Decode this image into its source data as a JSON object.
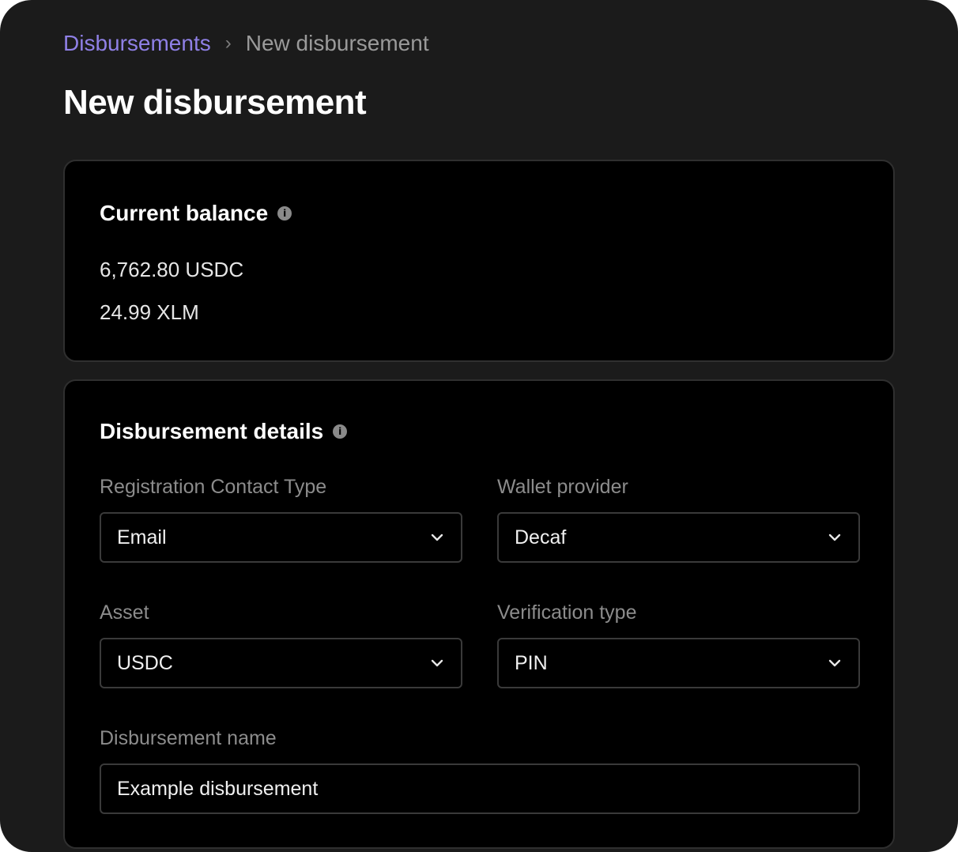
{
  "breadcrumb": {
    "parent": "Disbursements",
    "separator": "›",
    "current": "New disbursement"
  },
  "page_title": "New disbursement",
  "balance_card": {
    "title": "Current balance",
    "balances": [
      "6,762.80 USDC",
      "24.99 XLM"
    ]
  },
  "details_card": {
    "title": "Disbursement details",
    "registration_contact_type": {
      "label": "Registration Contact Type",
      "value": "Email"
    },
    "wallet_provider": {
      "label": "Wallet provider",
      "value": "Decaf"
    },
    "asset": {
      "label": "Asset",
      "value": "USDC"
    },
    "verification_type": {
      "label": "Verification type",
      "value": "PIN"
    },
    "disbursement_name": {
      "label": "Disbursement name",
      "value": "Example disbursement"
    }
  },
  "colors": {
    "background": "#1b1b1b",
    "card": "#000000",
    "link": "#8f80e6"
  },
  "icons": {
    "info": "info-icon",
    "dropdown": "chevron-down-icon"
  }
}
